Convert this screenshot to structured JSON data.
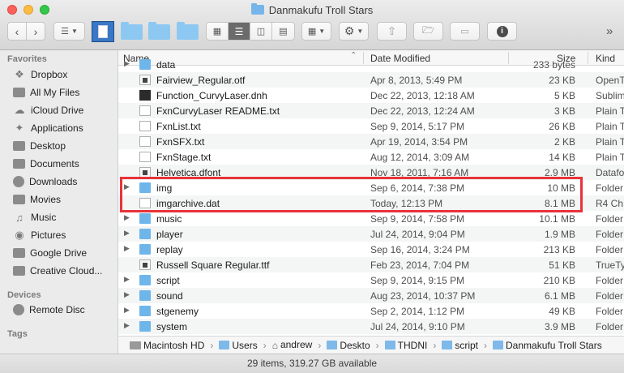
{
  "window": {
    "title": "Danmakufu Troll Stars"
  },
  "toolbar": {
    "view_options_label": "",
    "overflow_label": "»"
  },
  "sidebar": {
    "favorites_heading": "Favorites",
    "favorites": [
      {
        "label": "Dropbox",
        "icon": "dropbox-icon"
      },
      {
        "label": "All My Files",
        "icon": "all-files-icon"
      },
      {
        "label": "iCloud Drive",
        "icon": "cloud-icon"
      },
      {
        "label": "Applications",
        "icon": "applications-icon"
      },
      {
        "label": "Desktop",
        "icon": "desktop-icon"
      },
      {
        "label": "Documents",
        "icon": "documents-icon"
      },
      {
        "label": "Downloads",
        "icon": "downloads-icon"
      },
      {
        "label": "Movies",
        "icon": "movies-icon"
      },
      {
        "label": "Music",
        "icon": "music-icon"
      },
      {
        "label": "Pictures",
        "icon": "pictures-icon"
      },
      {
        "label": "Google Drive",
        "icon": "folder-icon"
      },
      {
        "label": "Creative Cloud...",
        "icon": "folder-icon"
      }
    ],
    "devices_heading": "Devices",
    "devices": [
      {
        "label": "Remote Disc",
        "icon": "disc-icon"
      }
    ],
    "tags_heading": "Tags"
  },
  "columns": {
    "name": "Name",
    "date": "Date Modified",
    "size": "Size",
    "kind": "Kind"
  },
  "files": [
    {
      "name": "data",
      "date": "",
      "size": "233 bytes",
      "kind": "",
      "type": "folder",
      "expandable": true,
      "partial": true
    },
    {
      "name": "Fairview_Regular.otf",
      "date": "Apr 8, 2013, 5:49 PM",
      "size": "23 KB",
      "kind": "OpenT",
      "type": "font"
    },
    {
      "name": "Function_CurvyLaser.dnh",
      "date": "Dec 22, 2013, 12:18 AM",
      "size": "5 KB",
      "kind": "Sublim",
      "type": "dark"
    },
    {
      "name": "FxnCurvyLaser README.txt",
      "date": "Dec 22, 2013, 12:24 AM",
      "size": "3 KB",
      "kind": "Plain T",
      "type": "doc"
    },
    {
      "name": "FxnList.txt",
      "date": "Sep 9, 2014, 5:17 PM",
      "size": "26 KB",
      "kind": "Plain T",
      "type": "doc"
    },
    {
      "name": "FxnSFX.txt",
      "date": "Apr 19, 2014, 3:54 PM",
      "size": "2 KB",
      "kind": "Plain T",
      "type": "doc"
    },
    {
      "name": "FxnStage.txt",
      "date": "Aug 12, 2014, 3:09 AM",
      "size": "14 KB",
      "kind": "Plain T",
      "type": "doc"
    },
    {
      "name": "Helvetica.dfont",
      "date": "Nov 18, 2011, 7:16 AM",
      "size": "2.9 MB",
      "kind": "Datafo",
      "type": "font"
    },
    {
      "name": "img",
      "date": "Sep 6, 2014, 7:38 PM",
      "size": "10 MB",
      "kind": "Folder",
      "type": "folder",
      "expandable": true
    },
    {
      "name": "imgarchive.dat",
      "date": "Today, 12:13 PM",
      "size": "8.1 MB",
      "kind": "R4 Ch",
      "type": "doc"
    },
    {
      "name": "music",
      "date": "Sep 9, 2014, 7:58 PM",
      "size": "10.1 MB",
      "kind": "Folder",
      "type": "folder",
      "expandable": true
    },
    {
      "name": "player",
      "date": "Jul 24, 2014, 9:04 PM",
      "size": "1.9 MB",
      "kind": "Folder",
      "type": "folder",
      "expandable": true
    },
    {
      "name": "replay",
      "date": "Sep 16, 2014, 3:24 PM",
      "size": "213 KB",
      "kind": "Folder",
      "type": "folder",
      "expandable": true
    },
    {
      "name": "Russell Square Regular.ttf",
      "date": "Feb 23, 2014, 7:04 PM",
      "size": "51 KB",
      "kind": "TrueTy",
      "type": "font"
    },
    {
      "name": "script",
      "date": "Sep 9, 2014, 9:15 PM",
      "size": "210 KB",
      "kind": "Folder",
      "type": "folder",
      "expandable": true
    },
    {
      "name": "sound",
      "date": "Aug 23, 2014, 10:37 PM",
      "size": "6.1 MB",
      "kind": "Folder",
      "type": "folder",
      "expandable": true
    },
    {
      "name": "stgenemy",
      "date": "Sep 2, 2014, 1:12 PM",
      "size": "49 KB",
      "kind": "Folder",
      "type": "folder",
      "expandable": true
    },
    {
      "name": "system",
      "date": "Jul 24, 2014, 9:10 PM",
      "size": "3.9 MB",
      "kind": "Folder",
      "type": "folder",
      "expandable": true
    }
  ],
  "pathbar": [
    {
      "label": "Macintosh HD",
      "icon": "hard-drive-icon"
    },
    {
      "label": "Users",
      "icon": "folder-icon"
    },
    {
      "label": "andrew",
      "icon": "home-icon"
    },
    {
      "label": "Deskto",
      "icon": "folder-icon"
    },
    {
      "label": "THDNI",
      "icon": "folder-icon"
    },
    {
      "label": "script",
      "icon": "folder-icon"
    },
    {
      "label": "Danmakufu Troll Stars",
      "icon": "folder-icon"
    }
  ],
  "status": {
    "text": "29 items, 319.27 GB available"
  },
  "colors": {
    "highlight_box": "#e8333a",
    "folder": "#6eb6ea"
  }
}
